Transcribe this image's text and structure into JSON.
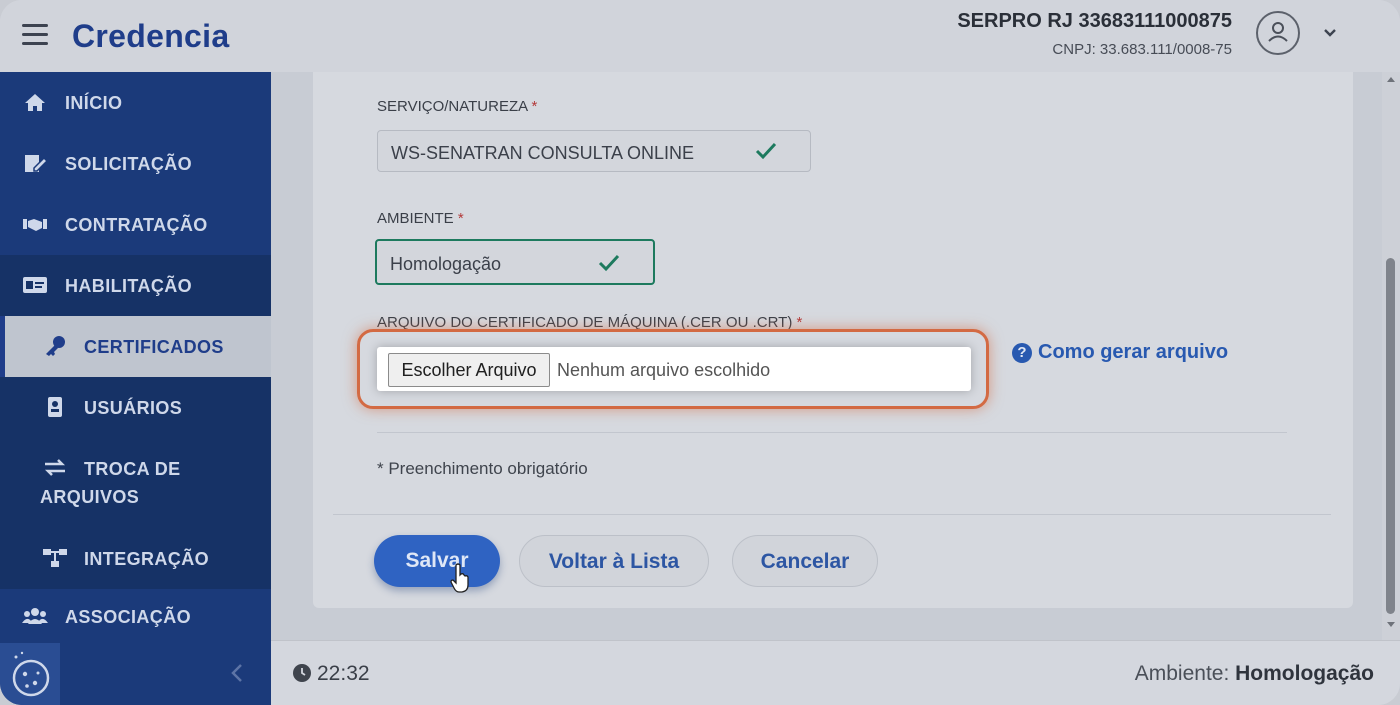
{
  "header": {
    "brand": "Credencia",
    "org_name": "SERPRO RJ 33683111000875",
    "org_cnpj": "CNPJ: 33.683.111/0008-75"
  },
  "sidebar": {
    "items": [
      {
        "label": "INÍCIO",
        "icon": "home-icon"
      },
      {
        "label": "SOLICITAÇÃO",
        "icon": "edit-document-icon"
      },
      {
        "label": "CONTRATAÇÃO",
        "icon": "handshake-icon"
      },
      {
        "label": "HABILITAÇÃO",
        "icon": "id-card-icon"
      },
      {
        "label": "CERTIFICADOS",
        "icon": "key-icon"
      },
      {
        "label": "USUÁRIOS",
        "icon": "user-badge-icon"
      },
      {
        "label": "TROCA DE",
        "label2": "ARQUIVOS",
        "icon": "swap-arrows-icon"
      },
      {
        "label": "INTEGRAÇÃO",
        "icon": "network-icon"
      },
      {
        "label": "ASSOCIAÇÃO",
        "icon": "users-group-icon"
      }
    ]
  },
  "form": {
    "servico_label": "SERVIÇO/NATUREZA",
    "servico_value": "WS-SENATRAN CONSULTA ONLINE",
    "ambiente_label": "AMBIENTE",
    "ambiente_value": "Homologação",
    "arquivo_label": "ARQUIVO DO CERTIFICADO DE MÁQUINA (.CER OU .CRT)",
    "required_mark": "*",
    "file_button": "Escolher Arquivo",
    "file_status": "Nenhum arquivo escolhido",
    "help_link": "Como gerar arquivo",
    "required_note": "* Preenchimento obrigatório"
  },
  "actions": {
    "save": "Salvar",
    "back": "Voltar à Lista",
    "cancel": "Cancelar"
  },
  "footer": {
    "time": "22:32",
    "env_label": "Ambiente:",
    "env_value": "Homologação"
  },
  "colors": {
    "brand": "#1f3d8a",
    "sidebar": "#1b3a7a",
    "primary_button": "#2f63c2",
    "valid_check": "#1d7a5e",
    "highlight": "#d36a43"
  }
}
